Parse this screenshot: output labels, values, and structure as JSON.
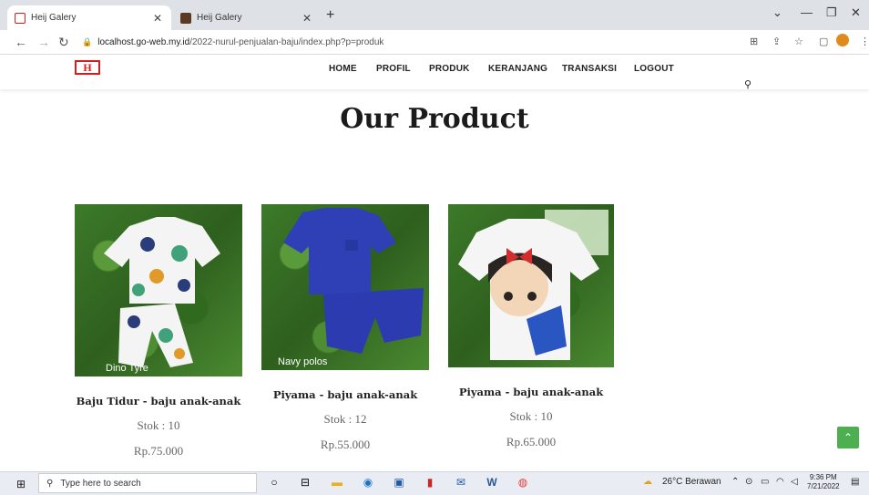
{
  "browser": {
    "tabs": [
      {
        "title": "Heij Galery",
        "active": true
      },
      {
        "title": "Heij Galery",
        "active": false
      }
    ],
    "url_host": "localhost.go-web.my.id",
    "url_path": "/2022-nurul-penjualan-baju/index.php?p=produk"
  },
  "site": {
    "logo": "H",
    "menu": [
      "HOME",
      "PROFIL",
      "PRODUK",
      "KERANJANG",
      "TRANSAKSI",
      "LOGOUT"
    ],
    "heading": "Our Product"
  },
  "products": [
    {
      "name": "Baju Tidur - baju anak-anak",
      "stock": "Stok : 10",
      "price": "Rp.75.000",
      "caption": "Dino Tyre"
    },
    {
      "name": "Piyama - baju anak-anak",
      "stock": "Stok : 12",
      "price": "Rp.55.000",
      "caption": "Navy polos"
    },
    {
      "name": "Piyama - baju anak-anak",
      "stock": "Stok : 10",
      "price": "Rp.65.000",
      "caption": ""
    }
  ],
  "taskbar": {
    "search_placeholder": "Type here to search",
    "weather": "26°C  Berawan",
    "time": "9:36 PM",
    "date": "7/21/2022"
  },
  "colors": {
    "accent_green": "#4caf50",
    "logo_red": "#d81c1c"
  }
}
